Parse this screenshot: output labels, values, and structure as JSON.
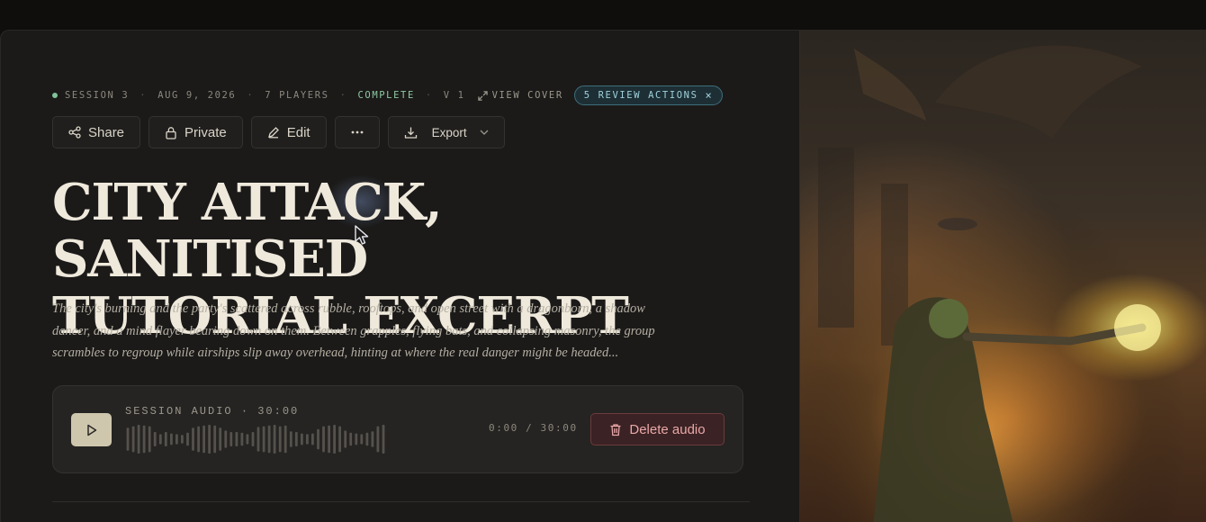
{
  "meta": {
    "session": "SESSION 3",
    "date": "AUG 9, 2026",
    "players": "7 PLAYERS",
    "status": "COMPLETE",
    "version": "V 1",
    "view_cover": "VIEW COVER",
    "review_actions": "5 REVIEW ACTIONS",
    "separator": "·"
  },
  "toolbar": {
    "share": "Share",
    "private": "Private",
    "edit": "Edit",
    "export": "Export"
  },
  "title": {
    "line1": "CITY ATTACK, SANITISED",
    "line2": "TUTORIAL EXCERPT"
  },
  "description": "The city's burning and the party's scattered across rubble, rooftops, and open street with a dragonborn, a shadow dancer, and a mind flayer bearing down on them. Between grapples, flying bats, and collapsing masonry, the group scrambles to regroup while airships slip away overhead, hinting at where the real danger might be headed...",
  "audio": {
    "label": "SESSION AUDIO · 30:00",
    "time": "0:00 / 30:00",
    "delete": "Delete audio",
    "progress": 0,
    "waveform": [
      0.8,
      0.9,
      1.0,
      0.95,
      0.9,
      0.5,
      0.35,
      0.5,
      0.4,
      0.35,
      0.3,
      0.45,
      0.8,
      0.9,
      0.95,
      1.0,
      0.95,
      0.8,
      0.6,
      0.5,
      0.5,
      0.45,
      0.35,
      0.5,
      0.85,
      0.9,
      0.95,
      1.0,
      0.9,
      0.95,
      0.55,
      0.5,
      0.4,
      0.35,
      0.4,
      0.7,
      0.9,
      0.95,
      1.0,
      0.9,
      0.6,
      0.45,
      0.4,
      0.35,
      0.45,
      0.55,
      0.9,
      1.0
    ]
  },
  "colors": {
    "accent_green": "#8fc9a1",
    "review_teal": "#9fd0dc",
    "delete_red": "#e9a8a8",
    "play_bg": "#cfc7ad"
  },
  "cover_image": "fantasy battle artwork: green-skinned sorcerer casting glowing magic, dragon silhouettes, burning city and airships"
}
